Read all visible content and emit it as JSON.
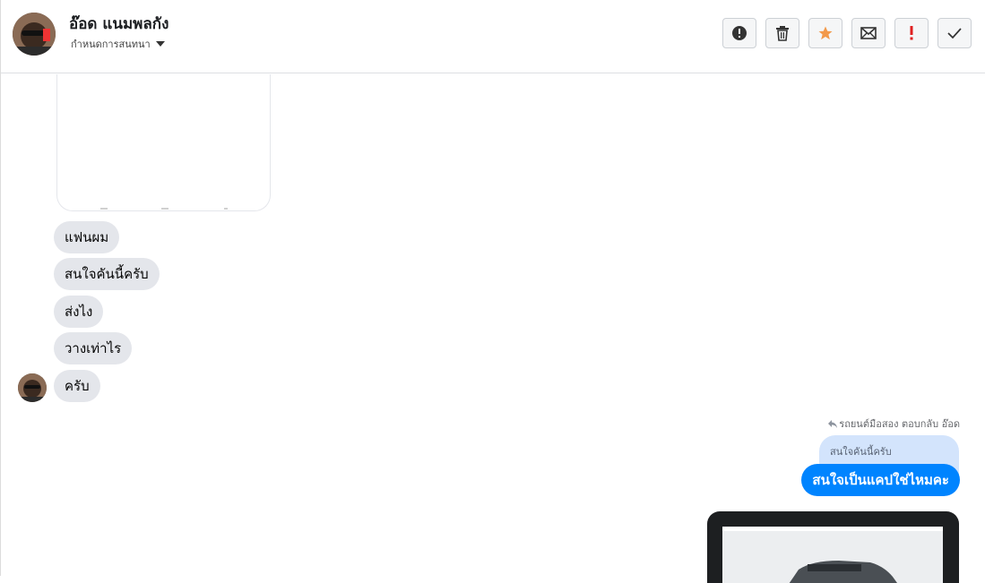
{
  "header": {
    "contact_name": "อ๊อด แนมพลกัง",
    "subtitle": "กำหนดการสนทนา",
    "actions": [
      {
        "id": "report",
        "icon": "alert-circle-icon"
      },
      {
        "id": "delete",
        "icon": "trash-icon"
      },
      {
        "id": "star",
        "icon": "star-icon",
        "color": "#f2994a"
      },
      {
        "id": "mark-unread",
        "icon": "envelope-icon"
      },
      {
        "id": "important",
        "icon": "exclamation-icon",
        "color": "#e02020"
      },
      {
        "id": "done",
        "icon": "checkmark-icon"
      }
    ]
  },
  "messages": {
    "received": [
      "แฟนผม",
      "สนใจคันนี้ครับ",
      "ส่งไง",
      "วางเท่าไร",
      "ครับ"
    ],
    "reply_meta": "รถยนต์มือสอง ตอบกลับ อ๊อด",
    "quoted_text": "สนใจคันนี้ครับ",
    "sent_text": "สนใจเป็นแคปใช่ไหมคะ"
  },
  "colors": {
    "accent": "#0084ff",
    "received_bubble": "#e4e6eb",
    "quoted_bubble": "#d3e4fc"
  }
}
